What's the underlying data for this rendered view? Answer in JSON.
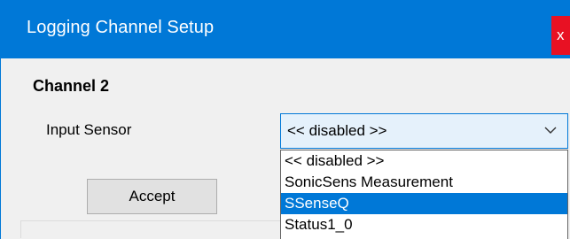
{
  "window": {
    "title": "Logging Channel Setup",
    "close_glyph": "x",
    "colors": {
      "titlebar": "#0078d7",
      "close": "#e81123",
      "selection": "#0078d7"
    }
  },
  "channel": {
    "title": "Channel 2"
  },
  "input_sensor": {
    "label": "Input Sensor",
    "selected": "<< disabled >>",
    "options": [
      "<< disabled >>",
      "SonicSens Measurement",
      "SSenseQ",
      "Status1_0"
    ],
    "highlighted_option": "SSenseQ"
  },
  "buttons": {
    "accept": "Accept"
  },
  "icons": {
    "dropdown": "chevron-down-icon",
    "close": "close-icon"
  }
}
